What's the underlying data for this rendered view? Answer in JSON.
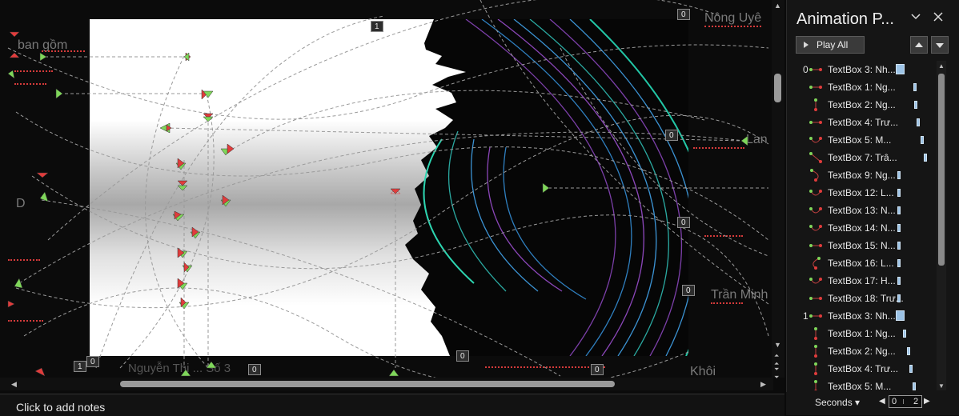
{
  "editor": {
    "ghost_text": [
      {
        "id": "nong-uyen",
        "text": "Nông Uyê"
      },
      {
        "id": "ban-gom",
        "text": "ban gồm"
      },
      {
        "id": "lan",
        "text": "Lan"
      },
      {
        "id": "d-left",
        "text": "D"
      },
      {
        "id": "tran-minh",
        "text": "Trần Minh"
      },
      {
        "id": "khoi",
        "text": "Khôi"
      },
      {
        "id": "bottom-mid",
        "text": "Nguyễn Thị ... Số 3"
      }
    ],
    "markers": [
      {
        "id": "m1",
        "text": "1"
      },
      {
        "id": "m2",
        "text": "0"
      },
      {
        "id": "m3",
        "text": "0"
      },
      {
        "id": "m4",
        "text": "0"
      },
      {
        "id": "m5",
        "text": "0"
      },
      {
        "id": "m6",
        "text": "0"
      },
      {
        "id": "m7",
        "text": "1"
      },
      {
        "id": "m8",
        "text": "0"
      },
      {
        "id": "m9",
        "text": "0"
      },
      {
        "id": "m10",
        "text": "0"
      }
    ],
    "colors": {
      "path_start": "#7fd65a",
      "path_end": "#e03c3c",
      "path_line": "#9a9a9a"
    }
  },
  "notes": {
    "placeholder": "Click to add notes"
  },
  "pane": {
    "title": "Animation P...",
    "play_all_label": "Play All",
    "icons": {
      "collapse": "chevron-down-icon",
      "close": "close-icon",
      "move_up": "arrow-up-icon",
      "move_down": "arrow-down-icon",
      "play": "play-icon"
    },
    "items": [
      {
        "num": "0",
        "label": "TextBox 3: Nh...",
        "bar": 0.0
      },
      {
        "num": "",
        "label": "TextBox 1: Ng...",
        "bar": 0.58
      },
      {
        "num": "",
        "label": "TextBox 2: Ng...",
        "bar": 0.62
      },
      {
        "num": "",
        "label": "TextBox 4: Trư...",
        "bar": 0.7
      },
      {
        "num": "",
        "label": "TextBox 5: M...",
        "bar": 0.85
      },
      {
        "num": "",
        "label": "TextBox 7: Trâ...",
        "bar": 0.97
      },
      {
        "num": "",
        "label": "TextBox 9: Ng...",
        "bar": 0.0
      },
      {
        "num": "",
        "label": "TextBox 12: L...",
        "bar": 0.0
      },
      {
        "num": "",
        "label": "TextBox 13: N...",
        "bar": 0.0
      },
      {
        "num": "",
        "label": "TextBox 14: N...",
        "bar": 0.0
      },
      {
        "num": "",
        "label": "TextBox 15: N...",
        "bar": 0.0
      },
      {
        "num": "",
        "label": "TextBox 16: L...",
        "bar": 0.0
      },
      {
        "num": "",
        "label": "TextBox 17: H...",
        "bar": 0.0
      },
      {
        "num": "",
        "label": "TextBox 18: Trư...",
        "bar": 0.0
      },
      {
        "num": "1",
        "label": "TextBox 3: Nh...",
        "bar": 0.0
      },
      {
        "num": "",
        "label": "TextBox 1: Ng...",
        "bar": 0.22
      },
      {
        "num": "",
        "label": "TextBox 2: Ng...",
        "bar": 0.35
      },
      {
        "num": "",
        "label": "TextBox 4: Trư...",
        "bar": 0.45
      },
      {
        "num": "",
        "label": "TextBox 5: M...",
        "bar": 0.55
      }
    ],
    "footer": {
      "seconds_label": "Seconds",
      "timeline_start": "0",
      "timeline_end": "2"
    }
  }
}
